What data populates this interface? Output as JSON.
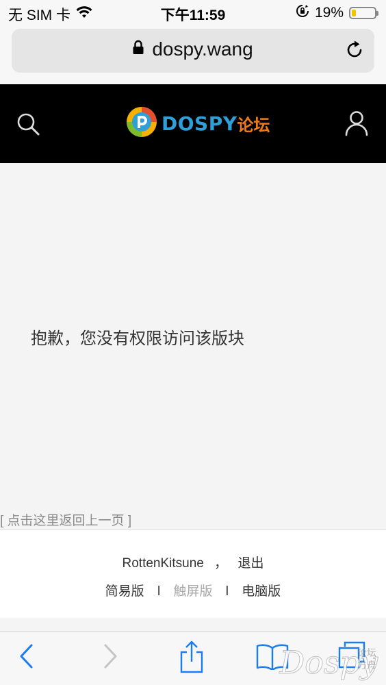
{
  "status": {
    "carrier": "无 SIM 卡",
    "time": "下午11:59",
    "battery": "19%",
    "battery_level": 0.19
  },
  "browser": {
    "url": "dospy.wang"
  },
  "site": {
    "logo_text": "DOSPY",
    "logo_cn": "论坛"
  },
  "main": {
    "message": "抱歉，您没有权限访问该版块",
    "back_link": "[ 点击这里返回上一页 ]"
  },
  "footer": {
    "username": "RottenKitsune",
    "comma": "，",
    "logout": "退出",
    "simple": "简易版",
    "touch": "触屏版",
    "desktop": "电脑版",
    "separator": "l"
  },
  "watermark": {
    "text": "Dospy",
    "small1": "论坛",
    "small2": "方舟"
  },
  "colors": {
    "accent": "#1a7cf0",
    "logo_blue": "#2f9fd8",
    "logo_orange": "#f07a10",
    "battery": "#f2c300"
  }
}
